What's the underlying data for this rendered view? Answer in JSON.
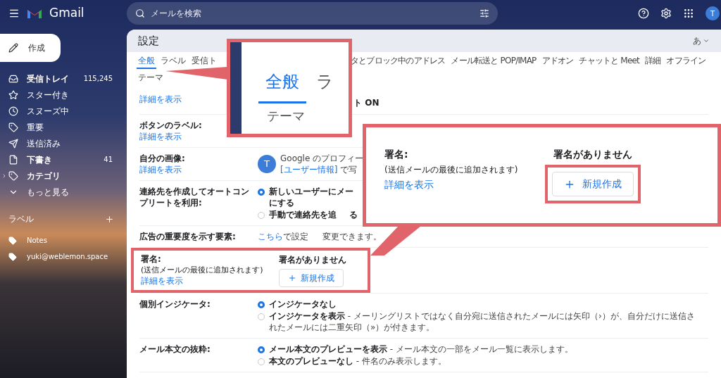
{
  "header": {
    "app_name": "Gmail",
    "search_placeholder": "メールを検索",
    "avatar_letter": "T"
  },
  "sidebar": {
    "compose": "作成",
    "items": [
      {
        "label": "受信トレイ",
        "count": "115,245",
        "bold": true
      },
      {
        "label": "スター付き",
        "bold": false
      },
      {
        "label": "スヌーズ中",
        "bold": false
      },
      {
        "label": "重要",
        "bold": false
      },
      {
        "label": "送信済み",
        "bold": false
      },
      {
        "label": "下書き",
        "count": "41",
        "bold": true
      },
      {
        "label": "カテゴリ",
        "bold": true
      },
      {
        "label": "もっと見る",
        "bold": false
      }
    ],
    "labels_heading": "ラベル",
    "labels": [
      {
        "label": "Notes"
      },
      {
        "label": "yuki@weblemon.space"
      }
    ]
  },
  "settings": {
    "title": "設定",
    "input_tool": "あ",
    "tabs": [
      {
        "label": "全般",
        "selected": true
      },
      {
        "label": "ラベル",
        "selected": false
      },
      {
        "label": "受信ト",
        "selected": false
      },
      {
        "label": "タとブロック中のアドレス",
        "selected": false
      },
      {
        "label": "メール転送と POP/IMAP",
        "selected": false
      },
      {
        "label": "アドオン",
        "selected": false
      },
      {
        "label": "チャットと Meet",
        "selected": false
      },
      {
        "label": "詳細",
        "selected": false
      },
      {
        "label": "オフライン",
        "selected": false
      },
      {
        "label": "テーマ",
        "selected": false
      }
    ],
    "rows": [
      {
        "kind": "plain",
        "link": "詳細を表示",
        "value": "ト ON"
      },
      {
        "kind": "plain",
        "label": "ボタンのラベル:",
        "link": "詳細を表示"
      },
      {
        "kind": "picture",
        "label": "自分の画像:",
        "link": "詳細を表示",
        "avatar": "T",
        "line1": "Google のプロフィー",
        "line2_link": "[ユーザー情報]",
        "line2": " で写"
      },
      {
        "kind": "radios",
        "label": "連絡先を作成してオートコンプリートを利用:",
        "options": [
          {
            "title": "新しいユーザーにメー",
            "cont": "にする",
            "selected": true
          },
          {
            "title": "手動で連絡先を追",
            "tail": "る",
            "selected": false
          }
        ]
      },
      {
        "kind": "link_text",
        "label": "広告の重要度を示す要素:",
        "here_link": "こちら",
        "text": "で設定",
        "tail": "変更できます。"
      },
      {
        "kind": "signature",
        "highlighted": true,
        "label": "署名:",
        "note": "(送信メールの最後に追加されます)",
        "link": "詳細を表示",
        "value": "署名がありません",
        "button": "新規作成"
      },
      {
        "kind": "radios",
        "label": "個別インジケータ:",
        "options": [
          {
            "title": "インジケータなし",
            "selected": true
          },
          {
            "title": "インジケータを表示",
            "description": " - メーリングリストではなく自分宛に送信されたメールには矢印（›）が、自分だけに送信されたメールには二重矢印（»）が付きます。",
            "selected": false
          }
        ]
      },
      {
        "kind": "radios",
        "label": "メール本文の抜粋:",
        "options": [
          {
            "title": "メール本文のプレビューを表示",
            "description": " - メール本文の一部をメール一覧に表示します。",
            "selected": true
          },
          {
            "title": "本文のプレビューなし",
            "description": " - 件名のみ表示します。",
            "selected": false
          }
        ]
      }
    ]
  },
  "callouts": [
    {
      "kind": "tabs_zoom",
      "tab": "全般",
      "next": "ラ",
      "second_row": "テーマ"
    },
    {
      "kind": "signature_zoom",
      "label": "署名:",
      "note": "(送信メールの最後に追加されます)",
      "link": "詳細を表示",
      "value": "署名がありません",
      "button": "新規作成"
    }
  ]
}
